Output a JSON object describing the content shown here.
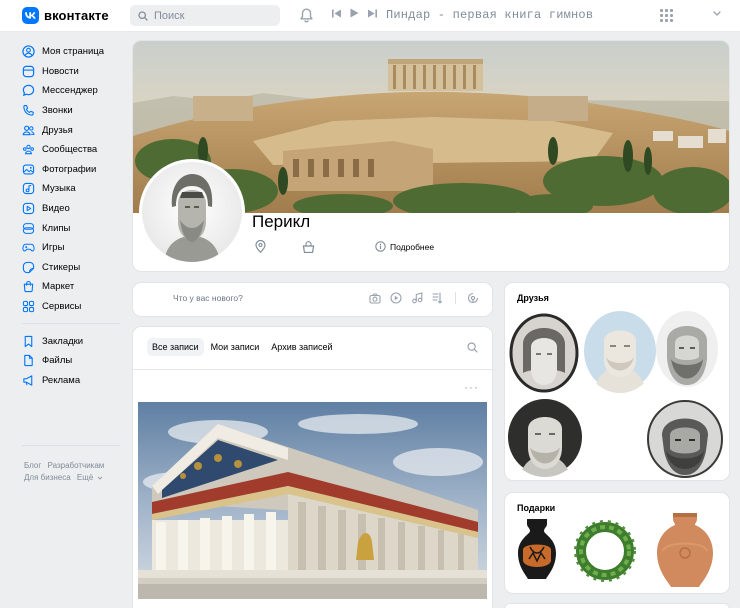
{
  "header": {
    "logo_text": "вконтакте",
    "logo_mark": "vk",
    "search_placeholder": "Поиск",
    "now_playing": "Пиндар - первая книга гимнов"
  },
  "sidebar": {
    "items": [
      {
        "label": "Моя страница",
        "icon": "user-circle-icon"
      },
      {
        "label": "Новости",
        "icon": "news-icon"
      },
      {
        "label": "Мессенджер",
        "icon": "message-icon"
      },
      {
        "label": "Звонки",
        "icon": "phone-icon"
      },
      {
        "label": "Друзья",
        "icon": "friends-icon"
      },
      {
        "label": "Сообщества",
        "icon": "communities-icon"
      },
      {
        "label": "Фотографии",
        "icon": "photo-icon"
      },
      {
        "label": "Музыка",
        "icon": "music-icon"
      },
      {
        "label": "Видео",
        "icon": "video-icon"
      },
      {
        "label": "Клипы",
        "icon": "clips-icon"
      },
      {
        "label": "Игры",
        "icon": "gamepad-icon"
      },
      {
        "label": "Стикеры",
        "icon": "sticker-icon"
      },
      {
        "label": "Маркет",
        "icon": "market-icon"
      },
      {
        "label": "Сервисы",
        "icon": "services-icon"
      }
    ],
    "secondary": [
      {
        "label": "Закладки",
        "icon": "bookmark-icon"
      },
      {
        "label": "Файлы",
        "icon": "file-icon"
      },
      {
        "label": "Реклама",
        "icon": "megaphone-icon"
      }
    ],
    "footer": {
      "blog": "Блог",
      "developers": "Разработчикам",
      "business": "Для бизнеса",
      "more": "Ещё"
    }
  },
  "profile": {
    "name": "Перикл",
    "more_info": "Подробнее"
  },
  "composer": {
    "placeholder": "Что у вас нового?"
  },
  "feed": {
    "tabs": [
      {
        "label": "Все записи",
        "active": true
      },
      {
        "label": "Мои записи",
        "active": false
      },
      {
        "label": "Архив записей",
        "active": false
      }
    ],
    "more": "···"
  },
  "friends": {
    "title": "Друзья"
  },
  "gifts": {
    "title": "Подарки"
  },
  "colors": {
    "accent": "#0077ff",
    "background": "#edeef0",
    "muted": "#818c99"
  }
}
